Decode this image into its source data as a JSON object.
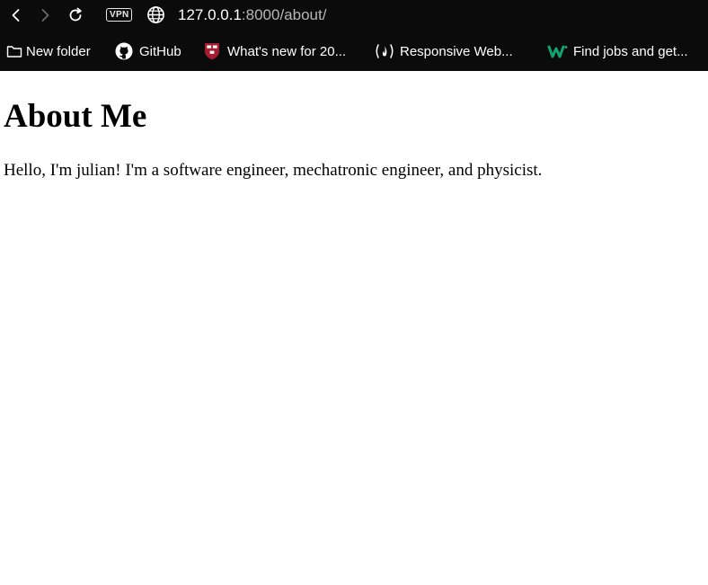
{
  "browser": {
    "nav": {
      "back_icon": "chevron-left-icon",
      "forward_icon": "chevron-right-icon",
      "reload_icon": "reload-icon"
    },
    "vpn_label": "VPN",
    "site_icon": "globe-icon",
    "url": {
      "host": "127.0.0.1",
      "path": ":8000/about/"
    },
    "bookmarks": [
      {
        "label": "New folder",
        "icon": "folder-icon"
      },
      {
        "label": "GitHub",
        "icon": "github-icon"
      },
      {
        "label": "What's new for 20...",
        "icon": "harvard-shield-icon",
        "color": "#a51c30"
      },
      {
        "label": "Responsive Web...",
        "icon": "freecodecamp-icon"
      },
      {
        "label": "Find jobs and get...",
        "icon": "wellfound-icon",
        "color": "#11a36b"
      }
    ],
    "colors": {
      "chrome_bg": "#0b0b0c",
      "text": "#ffffff",
      "url_path": "#b6b6b6"
    }
  },
  "page": {
    "heading": "About Me",
    "bio": "Hello, I'm julian! I'm a software engineer, mechatronic engineer, and physicist."
  }
}
